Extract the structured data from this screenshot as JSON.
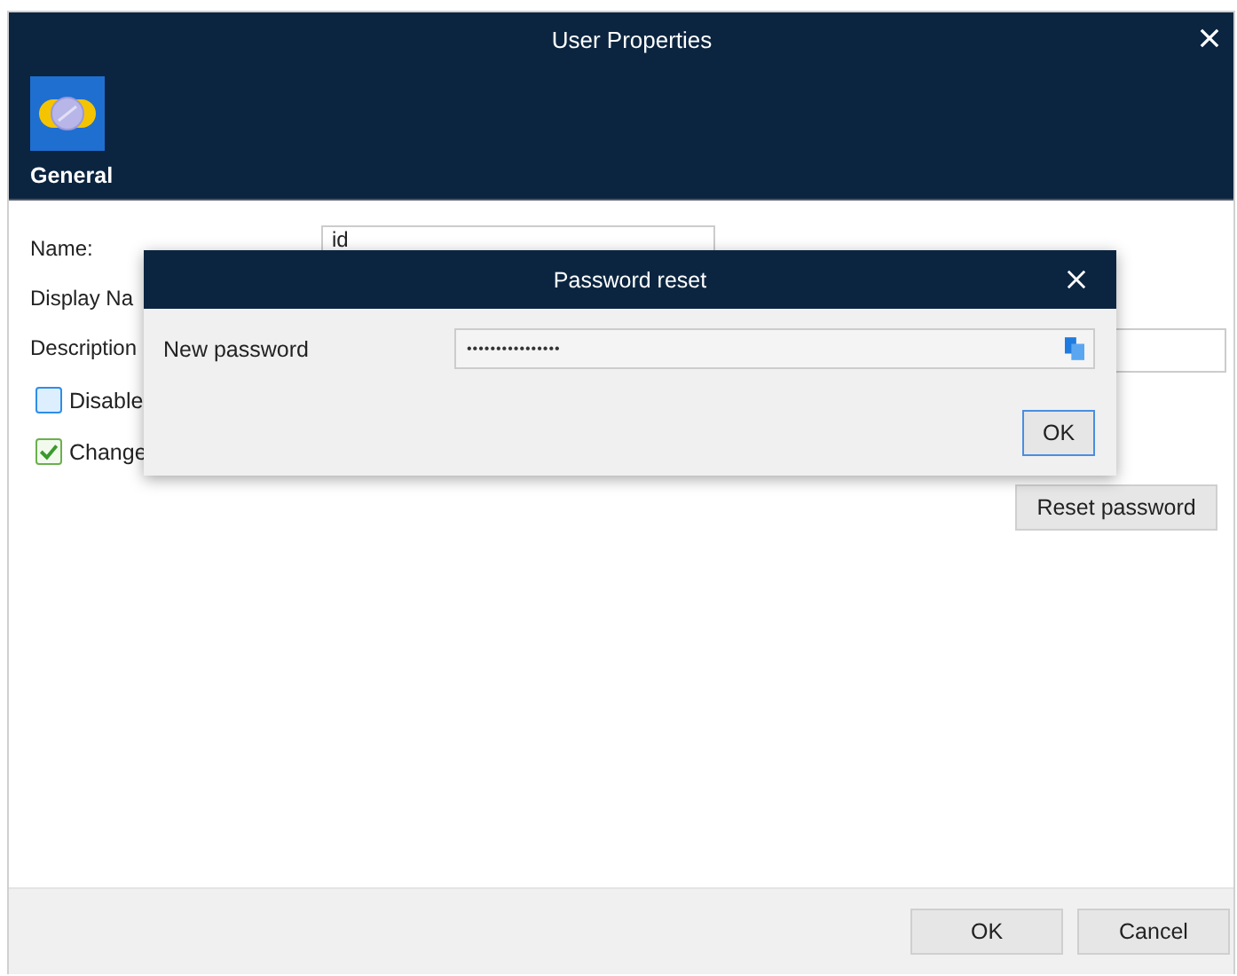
{
  "window": {
    "title": "User Properties"
  },
  "section": {
    "label": "General"
  },
  "form": {
    "name_label": "Name:",
    "name_value": "id",
    "display_name_label": "Display Na",
    "description_label": "Description",
    "checkboxes": [
      {
        "label": "Disable",
        "checked": false
      },
      {
        "label": "Change",
        "checked": true
      }
    ],
    "reset_button": "Reset password"
  },
  "dialog": {
    "title": "Password reset",
    "field_label": "New password",
    "field_value": "••••••••••••••••",
    "ok_button": "OK"
  },
  "buttons": [
    "OK",
    "Cancel"
  ]
}
